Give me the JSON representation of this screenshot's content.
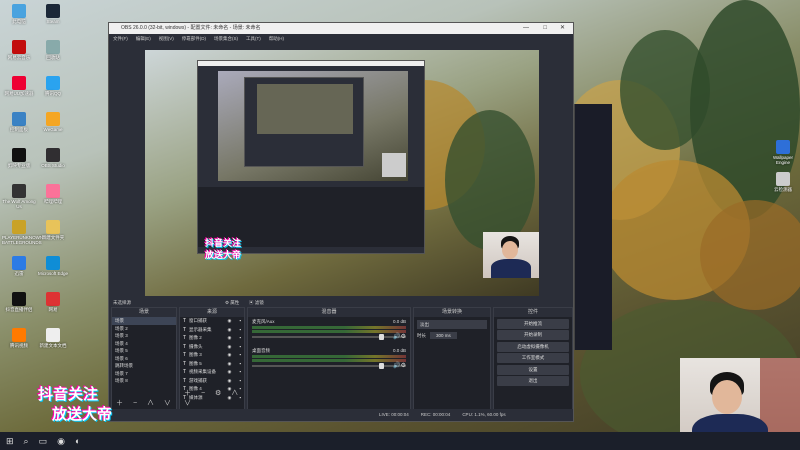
{
  "desktop": {
    "icons": [
      {
        "label": "此电脑",
        "color": "#4aa3df"
      },
      {
        "label": "Steam",
        "color": "#1b2838"
      },
      {
        "label": "网易云音乐",
        "color": "#c20c0c"
      },
      {
        "label": "回收站",
        "color": "#8aa"
      },
      {
        "label": "网易UU加速器",
        "color": "#e03"
      },
      {
        "label": "腾讯QQ",
        "color": "#2aa3ef"
      },
      {
        "label": "控制面板",
        "color": "#3b82c4"
      },
      {
        "label": "WeGame",
        "color": "#f5a623"
      },
      {
        "label": "剪映专业版",
        "color": "#111"
      },
      {
        "label": "OBS Studio",
        "color": "#302e31"
      },
      {
        "label": "The Wolf Among Us",
        "color": "#333"
      },
      {
        "label": "哔哩哔哩",
        "color": "#fb7299"
      },
      {
        "label": "PLAYERUNKNOWN'S BATTLEGROUNDS",
        "color": "#c9a227"
      },
      {
        "label": "新建文件夹",
        "color": "#e8c35a"
      },
      {
        "label": "迅雷",
        "color": "#2c7be5"
      },
      {
        "label": "Microsoft Edge",
        "color": "#0f8dd6"
      },
      {
        "label": "抖音直播伴侣",
        "color": "#111"
      },
      {
        "label": "网易",
        "color": "#d33"
      },
      {
        "label": "腾讯视频",
        "color": "#ff7a00"
      },
      {
        "label": "新建文本文档",
        "color": "#eee"
      }
    ],
    "right_icons": [
      {
        "label": "Wallpaper Engine",
        "color": "#2e6fd8"
      },
      {
        "label": "云检测器",
        "color": "#ccc"
      }
    ]
  },
  "obs": {
    "title": "OBS 26.0.0 (32-bit, windows) - 配置文件: 未命名 - 场景: 未命名",
    "menu": [
      "文件(F)",
      "编辑(E)",
      "视图(V)",
      "停靠部件(D)",
      "场景集合(S)",
      "工具(T)",
      "帮助(H)"
    ],
    "preview_label": "未选择源",
    "props_button": "属性",
    "filters_button": "滤镜",
    "scenes_header": "场景",
    "sources_header": "来源",
    "mixer_header": "混音器",
    "transition_header": "场景转换",
    "controls_header": "控件",
    "scenes": [
      "场景",
      "场景 2",
      "场景 3",
      "场景 4",
      "场景 5",
      "场景 6",
      "跳转场景",
      "场景 7",
      "场景 8"
    ],
    "sources": [
      "窗口捕获",
      "显示器采集",
      "图像 2",
      "摄像头",
      "图像 3",
      "图像 5",
      "视频采集设备",
      "游戏捕获",
      "图像 4",
      "媒体源"
    ],
    "mixer": [
      {
        "name": "麦克风/Aux",
        "db": "0.0 dB"
      },
      {
        "name": "桌面音频",
        "db": "0.0 dB"
      }
    ],
    "transition": {
      "type": "淡出",
      "duration_label": "时长",
      "duration": "300 ms"
    },
    "controls": [
      "开始推流",
      "开始录制",
      "启动虚拟摄像机",
      "工作室模式",
      "设置",
      "退出"
    ],
    "status": {
      "live": "LIVE: 00:00:04",
      "rec": "REC: 00:00:04",
      "cpu": "CPU: 1.1%, 60.00 fps"
    }
  },
  "overlay": {
    "line1": "抖音关注",
    "line2": "放送大帝"
  },
  "taskbar": {
    "start": "⊞",
    "search": "⌕",
    "items": [
      "▭",
      "◉",
      "◐"
    ]
  }
}
